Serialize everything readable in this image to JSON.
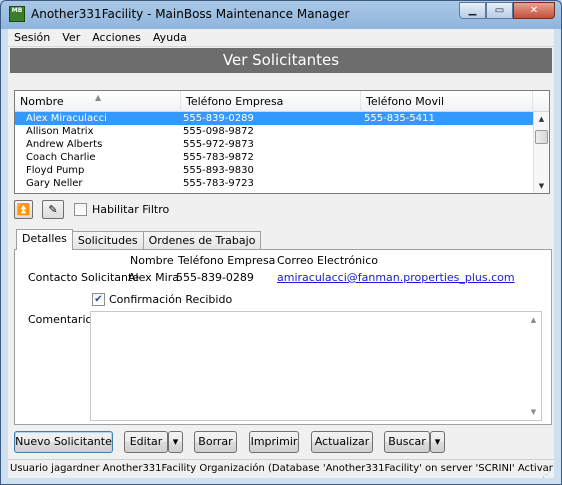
{
  "window": {
    "icon_text": "MB",
    "title": "Another331Facility - MainBoss Maintenance Manager",
    "minimize": "▁",
    "maximize": "▭",
    "close": "✕"
  },
  "menu": [
    "Sesión",
    "Ver",
    "Acciones",
    "Ayuda"
  ],
  "header": {
    "title": "Ver Solicitantes"
  },
  "list": {
    "columns": [
      "Nombre",
      "Teléfono Empresa",
      "Teléfono Movil"
    ],
    "rows": [
      {
        "name": "Alex Miraculacci",
        "phone": "555-839-0289",
        "mobile": "555-835-5411",
        "selected": true
      },
      {
        "name": "Allison Matrix",
        "phone": "555-098-9872",
        "mobile": ""
      },
      {
        "name": "Andrew Alberts",
        "phone": "555-972-9873",
        "mobile": ""
      },
      {
        "name": "Coach Charlie",
        "phone": "555-783-9872",
        "mobile": ""
      },
      {
        "name": "Floyd Pump",
        "phone": "555-893-9830",
        "mobile": ""
      },
      {
        "name": "Gary Neller",
        "phone": "555-783-9723",
        "mobile": ""
      }
    ]
  },
  "toolbar": {
    "filter_label": "Habilitar Filtro"
  },
  "tabs": [
    "Detalles",
    "Solicitudes",
    "Ordenes de Trabajo"
  ],
  "details": {
    "col_name": "Nombre",
    "col_phone": "Teléfono Empresa",
    "col_email": "Correo Electrónico",
    "contact_label": "Contacto Solicitante",
    "contact_name": "Alex Mira",
    "contact_phone": "555-839-0289",
    "contact_email": "amiraculacci@fanman.properties_plus.com",
    "confirm_label": "Confirmación Recibido",
    "confirm_checked": true,
    "comments_label": "Comentarios"
  },
  "buttons": {
    "new": "Nuevo Solicitante",
    "edit": "Editar",
    "delete": "Borrar",
    "print": "Imprimir",
    "refresh": "Actualizar",
    "search": "Buscar"
  },
  "status": "Usuario jagardner Another331Facility Organización (Database 'Another331Facility' on server 'SCRINI' Activar"
}
